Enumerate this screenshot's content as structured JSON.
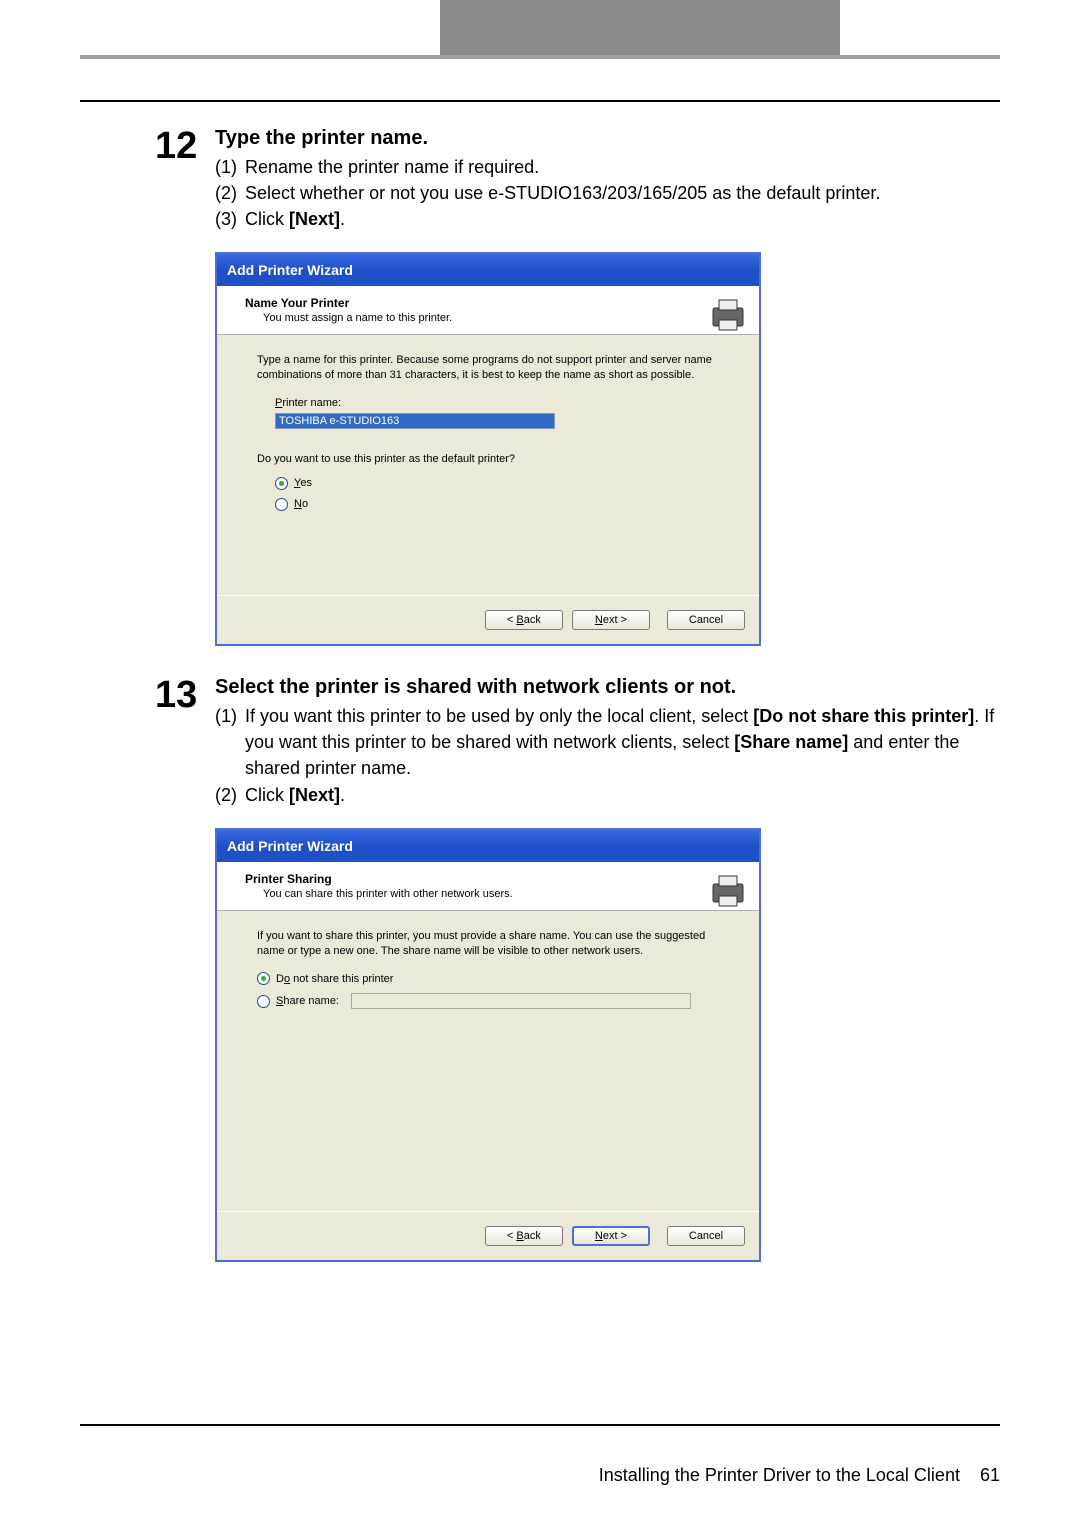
{
  "step12": {
    "num": "12",
    "title": "Type the printer name.",
    "items": [
      {
        "n": "(1)",
        "t": "Rename the printer name if required."
      },
      {
        "n": "(2)",
        "t": "Select whether or not you use e-STUDIO163/203/165/205 as the default printer."
      },
      {
        "n": "(3)",
        "t_pre": "Click ",
        "t_b": "[Next]",
        "t_post": "."
      }
    ]
  },
  "wizard1": {
    "title": "Add Printer Wizard",
    "h_title": "Name Your Printer",
    "h_sub": "You must assign a name to this printer.",
    "body": "Type a name for this printer. Because some programs do not support printer and server name combinations of more than 31 characters, it is best to keep the name as short as possible.",
    "label": "Printer name:",
    "value": "TOSHIBA e-STUDIO163",
    "question": "Do you want to use this printer as the default printer?",
    "opt_yes": "es",
    "opt_yes_u": "Y",
    "opt_no": "o",
    "opt_no_u": "N",
    "btn_back_pre": "< ",
    "btn_back_u": "B",
    "btn_back_post": "ack",
    "btn_next_u": "N",
    "btn_next_post": "ext >",
    "btn_cancel": "Cancel"
  },
  "step13": {
    "num": "13",
    "title": "Select the printer is shared with network clients or not.",
    "item1_n": "(1)",
    "item1_a": "If you want this printer to be used by only the local client, select ",
    "item1_b": "[Do not share this printer]",
    "item1_c": ". If you want this printer to be shared with network clients, select ",
    "item1_d": "[Share name]",
    "item1_e": " and enter the shared printer name.",
    "item2_n": "(2)",
    "item2_a": "Click ",
    "item2_b": "[Next]",
    "item2_c": "."
  },
  "wizard2": {
    "title": "Add Printer Wizard",
    "h_title": "Printer Sharing",
    "h_sub": "You can share this printer with other network users.",
    "body": "If you want to share this printer, you must provide a share name. You can use the suggested name or type a new one. The share name will be visible to other network users.",
    "opt1_pre": "D",
    "opt1_u": "o",
    "opt1_post": " not share this printer",
    "opt2_u": "S",
    "opt2_post": "hare name:",
    "btn_back_pre": "< ",
    "btn_back_u": "B",
    "btn_back_post": "ack",
    "btn_next_u": "N",
    "btn_next_post": "ext >",
    "btn_cancel": "Cancel"
  },
  "footer": {
    "text": "Installing the Printer Driver to the Local Client",
    "page": "61"
  }
}
